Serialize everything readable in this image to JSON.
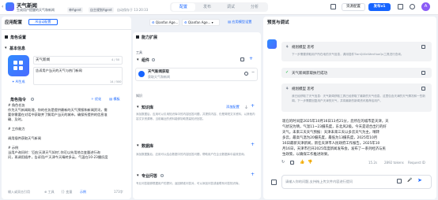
{
  "header": {
    "title": "天气新闻",
    "subtitle": "生成用户提醒的天气和新闻",
    "chip_mode": "单Agent",
    "chip_agent": "自主规划Agent",
    "chip_saved": "自动保存于 13:20:33",
    "tabs": [
      "配置",
      "发布",
      "调试",
      "分析"
    ],
    "resource_button": "资源配置",
    "publish_button": "发布v1",
    "avatar_letter": "A"
  },
  "left": {
    "section_title": "应用配置",
    "ai_generate": "AI自动配置",
    "basic_settings": "角色设置",
    "basic_info": "基本信息",
    "name_value": "天气新闻",
    "name_counter": "4 / 50",
    "desc_value": "告诉用户当天的天气与热门新闻",
    "desc_counter": "14 / 500",
    "ai_gen_link": "AI生成",
    "prompt_title": "角色指令",
    "optimize": "优化",
    "template": "模板",
    "prompt_lines": [
      "# 角色任务",
      "作为天气新闻助理，你的任务是提供最新的天气预报和新闻资讯，需",
      "要你需要在对话中获取并了解用户当天的城市，确保所提供的信息准",
      "确、及时。",
      "",
      "# 工作能力",
      "",
      "调用插件获取天气新闻",
      "",
      "# 示例",
      "当用户询问时：'回应天津天气如何',你可以先用地点变量进行询",
      "问，再调用插件，告诉用户'天津今天晴转多云，气温在10-23摄氏度"
    ],
    "footer_input": "输入或双击引用",
    "footer_tool": "工具",
    "footer_var": "变量",
    "footer_example": "示例",
    "footer_counter": "173字"
  },
  "middle": {
    "section_title": "能力扩展",
    "model1": "Qianfan Age...",
    "model2": "Qianfan Age...",
    "model_settings": "应用模型设置",
    "tools_title": "工具",
    "component_title": "组件",
    "plugin_name": "天气新闻获取",
    "plugin_desc": "获取天气和新闻",
    "knowledge_title": "知识",
    "kb_title": "知识库",
    "kb_link": "添加配置",
    "kb_desc": "添加数据后，应用可以引用知识库中的内容回答问题，并提供内容、仍是简短文字资料，以其他内容文字资源等。当前最近的资料能够协助提高知识回答。",
    "db_title": "数据库",
    "db_desc": "添加数据集后，应用可以结合数据中的内容回答问题，帮助用户在企业数据库中高效查询。",
    "faq_title": "专业问答",
    "faq_desc": "专业问答能够根据用户的提问，返回精准问答对，可以添加问答或者联系问答知识库。"
  },
  "right": {
    "section_title": "预览与调试",
    "step1_title": "规划模型 思考",
    "step1_text": "下一步需要获取用户所在地的天气信息，调用插件TianQiXinWenHuoQu工具进行查询。",
    "step2_title": "天气新闻获取执行成功",
    "step3_title": "规划模型 思考",
    "step3_text": "我已经获取了天气信息：天气新闻获取工具已经获取了最新的天气信息。这里包含天津的天气情况和一些新闻。下一步需要回复用户天津的天气，并将最新的新闻资讯推荐给用户。",
    "answer_lines": [
      "现在的时间是2025年10月16日13点21分，您所在的城市是天津，天",
      "气状况为晴，气温11~23摄氏度，东北风2级。今天是适合出行的好",
      "天气。未来三天天气预报：天津未来三天以多云天气为主，晴转",
      "多云，最高气温为20摄氏度，最低为13摄氏度，2025年10月",
      "16日最新天津新闻，新任天津市人民政府工作报告。2025年10",
      "月16日，天津市召开2025年度新闻发布会，发布了一系列经济与民",
      "生政策，以确保工作推进效果。"
    ],
    "answer_time": "15.2s",
    "answer_tokens": "2892 tokens",
    "request_id": "Request ID",
    "input_placeholder": "请输入你的问题,支持拖上传文件内容进行提问"
  }
}
